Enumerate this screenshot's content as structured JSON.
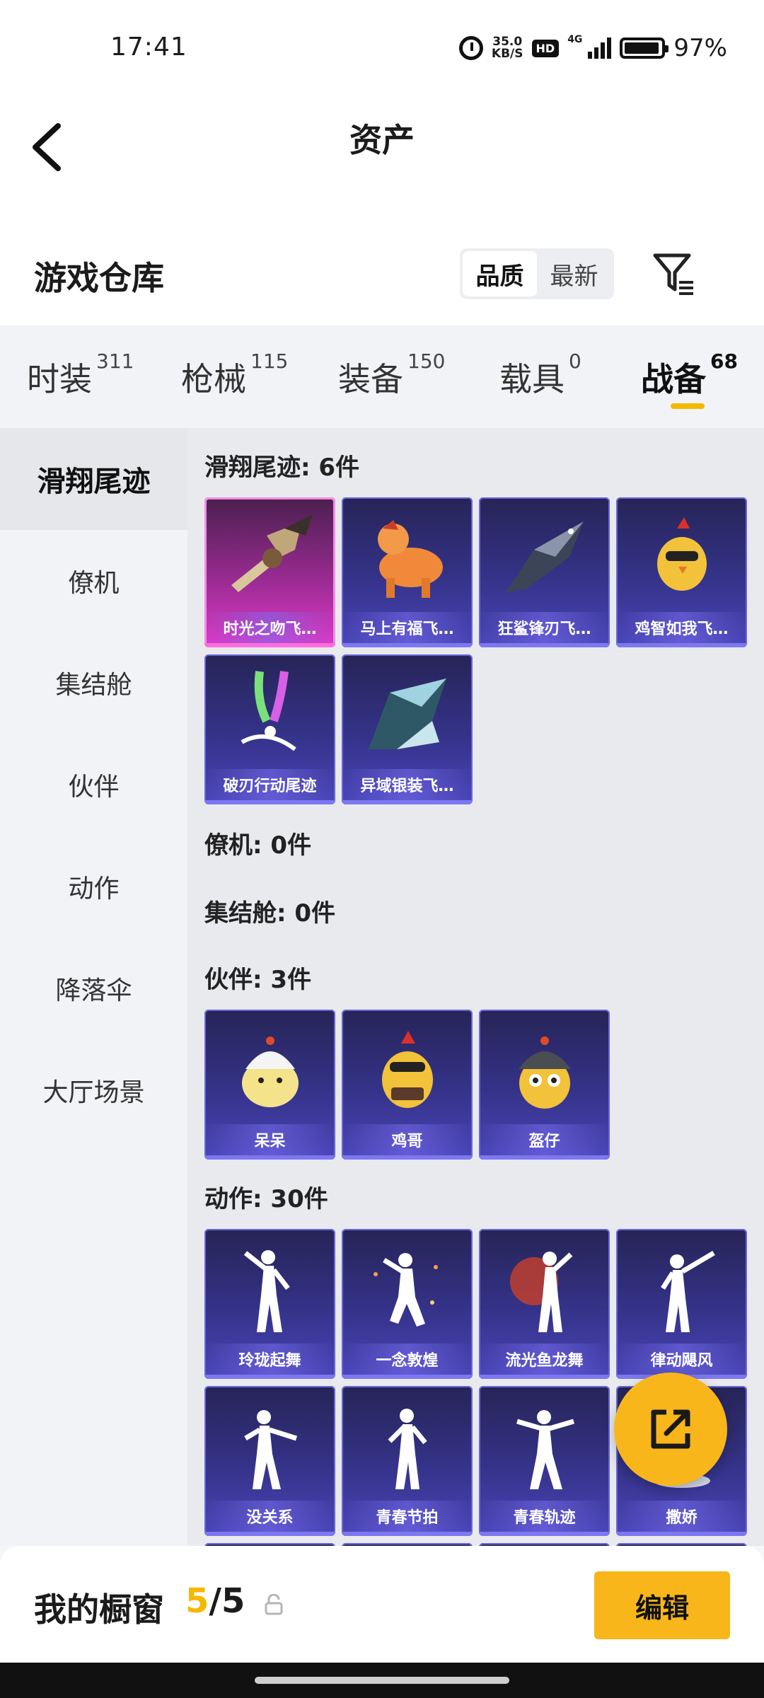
{
  "status_bar": {
    "time": "17:41",
    "net_speed_value": "35.0",
    "net_speed_unit": "KB/S",
    "hd": "HD",
    "network": "4G",
    "battery": "97%"
  },
  "header": {
    "title": "资产"
  },
  "section": {
    "title": "游戏仓库",
    "sort_options": [
      "品质",
      "最新"
    ],
    "active_sort": "品质"
  },
  "tabs": [
    {
      "label": "时装",
      "count": "311"
    },
    {
      "label": "枪械",
      "count": "115"
    },
    {
      "label": "装备",
      "count": "150"
    },
    {
      "label": "载具",
      "count": "0"
    },
    {
      "label": "战备",
      "count": "68"
    }
  ],
  "sidebar": {
    "items": [
      "滑翔尾迹",
      "僚机",
      "集结舱",
      "伙伴",
      "动作",
      "降落伞",
      "大厅场景"
    ],
    "active": "滑翔尾迹"
  },
  "categories": {
    "glide": {
      "title": "滑翔尾迹: 6件",
      "items": [
        "时光之吻飞…",
        "马上有福飞…",
        "狂鲨锋刃飞…",
        "鸡智如我飞…",
        "破刃行动尾迹",
        "异域银装飞…"
      ]
    },
    "wingman": {
      "title": "僚机: 0件"
    },
    "pod": {
      "title": "集结舱: 0件"
    },
    "partner": {
      "title": "伙伴: 3件",
      "items": [
        "呆呆",
        "鸡哥",
        "盔仔"
      ]
    },
    "emote": {
      "title": "动作: 30件",
      "items": [
        "玲珑起舞",
        "一念敦煌",
        "流光鱼龙舞",
        "律动飓风",
        "没关系",
        "青春节拍",
        "青春轨迹",
        "撒娇"
      ]
    }
  },
  "bottom": {
    "title": "我的橱窗",
    "count_current": "5",
    "count_sep": "/",
    "count_total": "5",
    "edit_label": "编辑"
  },
  "colors": {
    "accent": "#f8b61a",
    "card_blue": "#35338a",
    "card_pink": "#9a2b92"
  }
}
